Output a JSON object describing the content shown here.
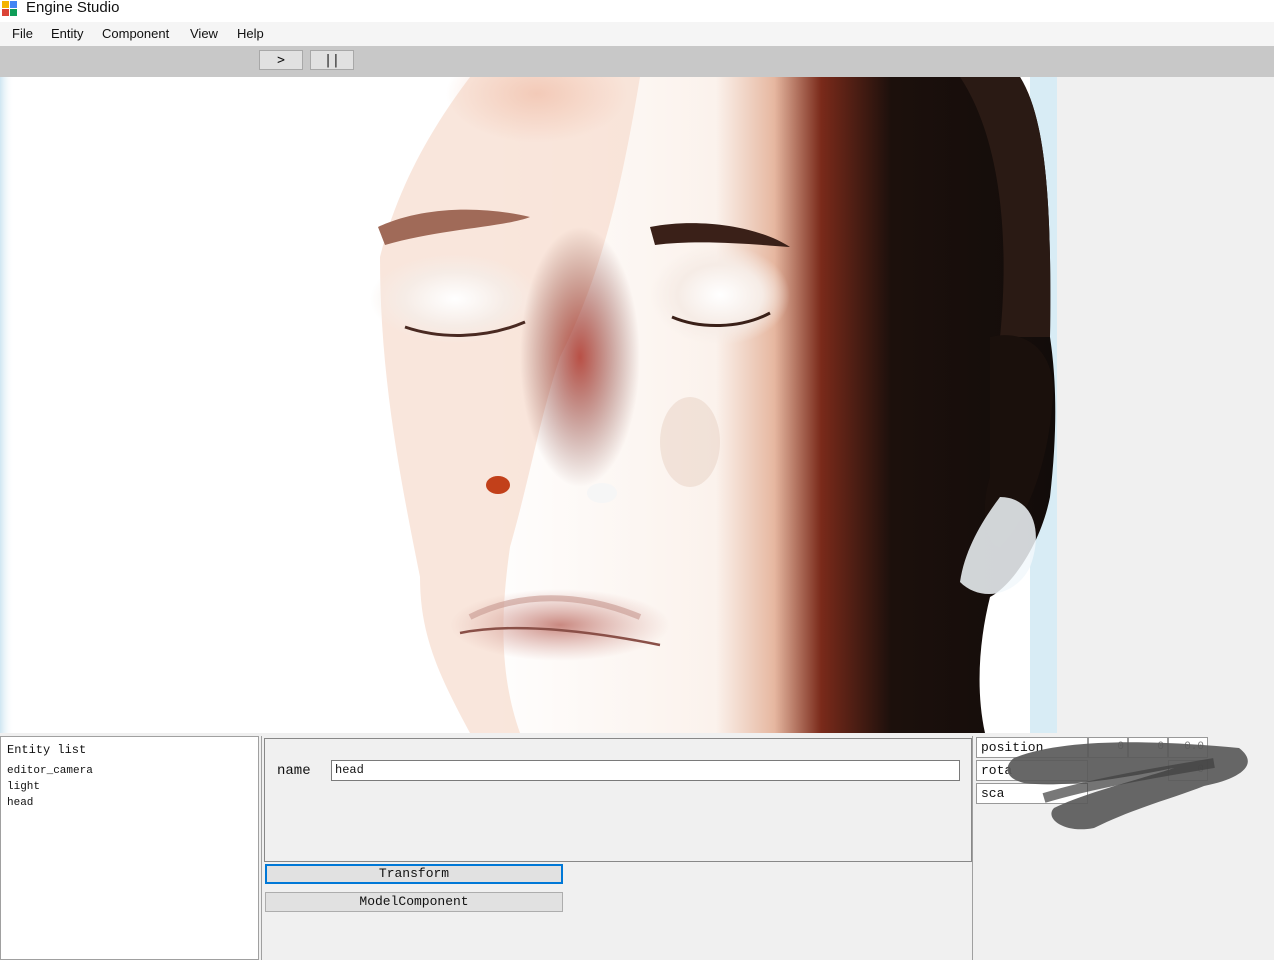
{
  "window": {
    "title": "Engine Studio"
  },
  "menu": [
    "File",
    "Entity",
    "Component",
    "View",
    "Help"
  ],
  "toolbar": {
    "play_label": ">",
    "pause_label": "||"
  },
  "entity_list": {
    "title": "Entity list",
    "items": [
      "editor_camera",
      "light",
      "head"
    ]
  },
  "properties": {
    "name_label": "name",
    "name_value": "head",
    "components": [
      "Transform",
      "ModelComponent"
    ]
  },
  "transform": {
    "rows": [
      {
        "label": "position",
        "values": [
          "0",
          "0",
          "0.0"
        ]
      },
      {
        "label": "rota",
        "values": [
          "",
          "",
          "0"
        ]
      },
      {
        "label": "sca",
        "values": [
          "",
          "",
          ""
        ]
      }
    ]
  },
  "colors": {
    "accent_focus": "#0078d7",
    "toolbar_bg": "#c8c8c8",
    "panel_bg": "#f0f0f0"
  }
}
